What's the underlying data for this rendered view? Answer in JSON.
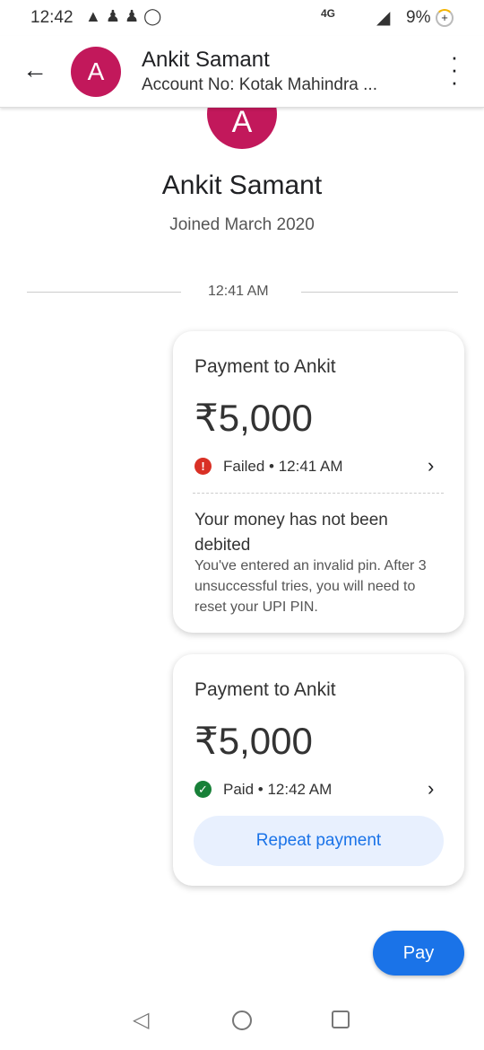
{
  "status_bar": {
    "time": "12:42",
    "battery": "9%",
    "network": "4G"
  },
  "header": {
    "avatar_letter": "A",
    "name": "Ankit Samant",
    "subtitle": "Account No: Kotak Mahindra ..."
  },
  "profile": {
    "avatar_letter": "A",
    "name": "Ankit Samant",
    "joined": "Joined March 2020"
  },
  "timestamp": "12:41 AM",
  "payments": [
    {
      "title": "Payment to Ankit",
      "amount": "₹5,000",
      "status": "Failed",
      "time": "• 12:41 AM",
      "message_title": "Your money has not been debited",
      "message_body": "You've entered an invalid pin. After 3 unsuccessful tries, you will need to reset your UPI PIN."
    },
    {
      "title": "Payment to Ankit",
      "amount": "₹5,000",
      "status": "Paid",
      "time": "• 12:42 AM",
      "action": "Repeat payment"
    }
  ],
  "pay_button": "Pay",
  "colors": {
    "failed": "#d93025",
    "paid": "#188038",
    "primary": "#1a73e8",
    "avatar": "#c2185b"
  }
}
